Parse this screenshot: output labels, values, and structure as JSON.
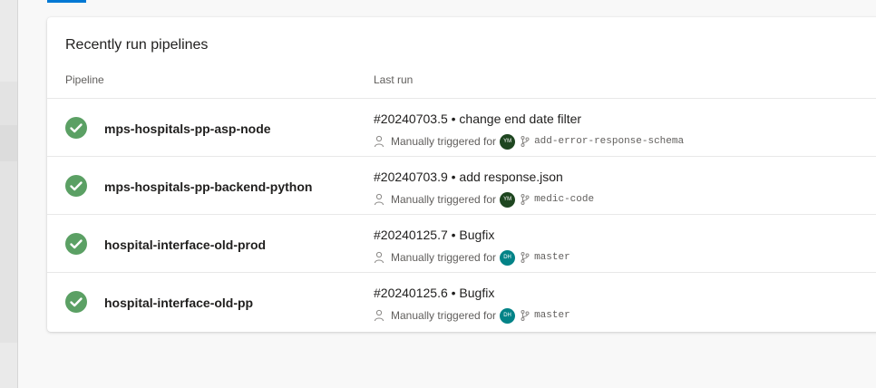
{
  "card": {
    "title": "Recently run pipelines",
    "columns": {
      "pipeline": "Pipeline",
      "last_run": "Last run"
    }
  },
  "rows": [
    {
      "status": "succeeded",
      "pipeline": "mps-hospitals-pp-asp-node",
      "run": "#20240703.5 • change end date filter",
      "trigger": "Manually triggered for",
      "avatar_initials": "YM",
      "avatar_color": "#1e4620",
      "branch": "add-error-response-schema"
    },
    {
      "status": "succeeded",
      "pipeline": "mps-hospitals-pp-backend-python",
      "run": "#20240703.9 • add response.json",
      "trigger": "Manually triggered for",
      "avatar_initials": "YM",
      "avatar_color": "#1e4620",
      "branch": "medic-code"
    },
    {
      "status": "succeeded",
      "pipeline": "hospital-interface-old-prod",
      "run": "#20240125.7 • Bugfix",
      "trigger": "Manually triggered for",
      "avatar_initials": "DH",
      "avatar_color": "#038387",
      "branch": "master"
    },
    {
      "status": "succeeded",
      "pipeline": "hospital-interface-old-pp",
      "run": "#20240125.6 • Bugfix",
      "trigger": "Manually triggered for",
      "avatar_initials": "DH",
      "avatar_color": "#038387",
      "branch": "master"
    }
  ],
  "colors": {
    "success": "#5ba064",
    "accent": "#0078d4"
  },
  "icons": {
    "status": "check-circle-icon",
    "trigger": "person-icon",
    "branch": "git-branch-icon"
  }
}
